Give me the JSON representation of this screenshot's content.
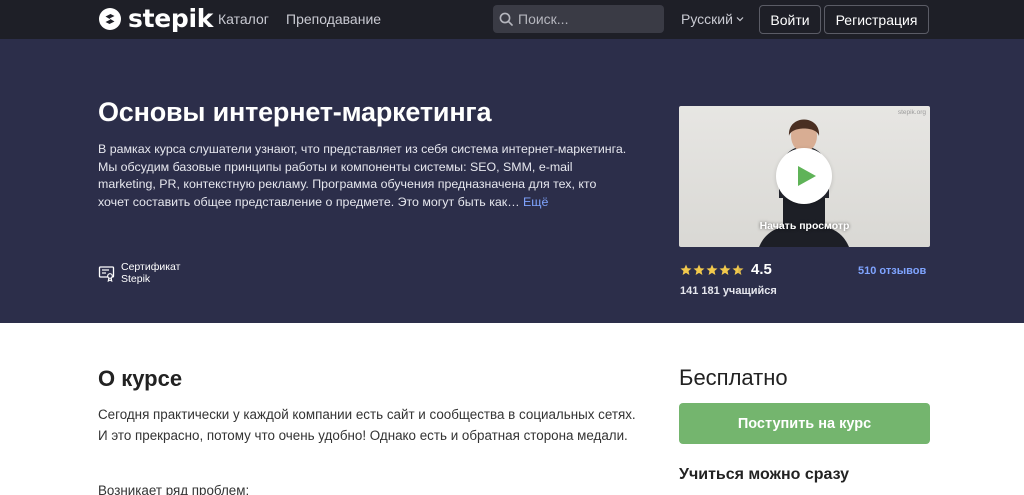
{
  "header": {
    "logo_text": "stepik",
    "nav": [
      {
        "label": "Каталог"
      },
      {
        "label": "Преподавание"
      }
    ],
    "search": {
      "placeholder": "Поиск..."
    },
    "language": {
      "selected": "Русский"
    },
    "login_label": "Войти",
    "register_label": "Регистрация"
  },
  "hero": {
    "title": "Основы интернет-маркетинга",
    "description": "В рамках курса слушатели узнают, что представляет из себя система интернет-маркетинга. Мы обсудим базовые принципы работы и компоненты системы: SEO, SMM, e-mail marketing, PR, контекстную рекламу. Программа обучения предназначена для тех, кто хочет составить общее представление о предмете. Это могут быть как…",
    "more_link": "Ещё",
    "certificate_line1": "Сертификат",
    "certificate_line2": "Stepik",
    "video": {
      "watermark": "stepik.org",
      "caption": "Начать просмотр"
    },
    "rating": {
      "value": "4.5",
      "stars_filled": 4.5,
      "stars_total": 5
    },
    "reviews_link": "510 отзывов",
    "learners": "141 181 учащийся"
  },
  "about": {
    "heading": "О курсе",
    "paragraph1": "Сегодня практически у каждой компании есть сайт и сообщества в социальных сетях. И это прекрасно, потому что очень удобно! Однако есть и обратная сторона медали.",
    "paragraph2": "Возникает ряд проблем:"
  },
  "sidebar": {
    "price": "Бесплатно",
    "enroll_label": "Поступить на курс",
    "start_now": "Учиться можно сразу"
  },
  "colors": {
    "topbar_bg": "#1e1f27",
    "hero_bg": "#2c2e4a",
    "accent_link": "#7fa4ff",
    "enroll_green": "#74b56e",
    "star_yellow": "#f2c94c",
    "play_green": "#5fb358"
  }
}
